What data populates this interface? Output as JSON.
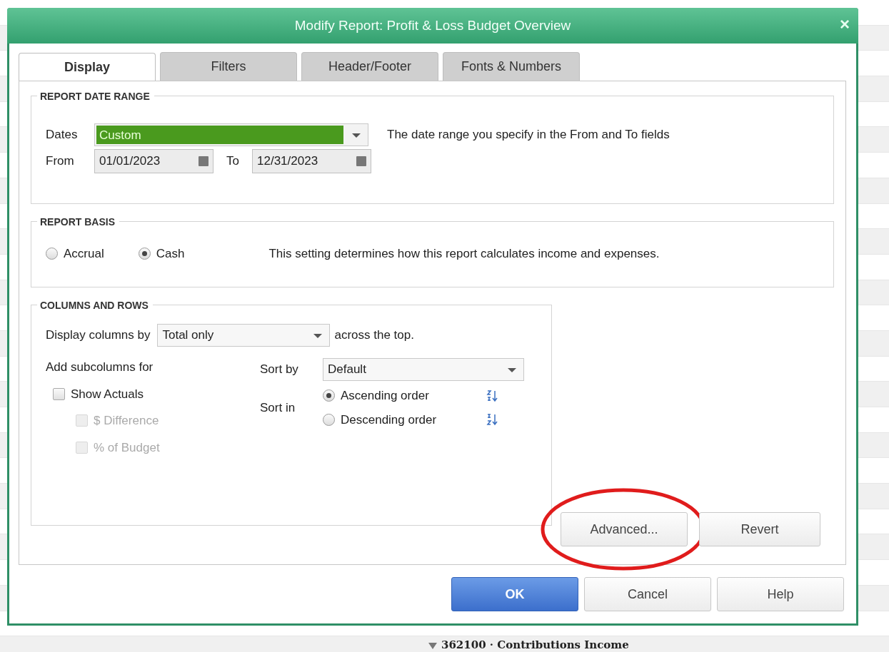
{
  "window": {
    "title": "Modify Report: Profit & Loss Budget Overview",
    "close": "×"
  },
  "tabs": [
    {
      "label": "Display",
      "selected": true
    },
    {
      "label": "Filters",
      "selected": false
    },
    {
      "label": "Header/Footer",
      "selected": false
    },
    {
      "label": "Fonts & Numbers",
      "selected": false
    }
  ],
  "date_range": {
    "heading": "REPORT DATE RANGE",
    "dates_label": "Dates",
    "dates_value": "Custom",
    "hint": "The date range you specify in the From and To fields",
    "from_label": "From",
    "from_value": "01/01/2023",
    "to_label": "To",
    "to_value": "12/31/2023"
  },
  "report_basis": {
    "heading": "REPORT BASIS",
    "options": [
      {
        "label": "Accrual",
        "selected": false
      },
      {
        "label": "Cash",
        "selected": true
      }
    ],
    "hint": "This setting determines how this report calculates income and expenses."
  },
  "columns_rows": {
    "heading": "COLUMNS AND ROWS",
    "display_label": "Display columns by",
    "display_value": "Total only",
    "display_suffix": "across the top.",
    "subcolumns_label": "Add subcolumns for",
    "subcolumns": [
      {
        "label": "Show Actuals",
        "checked": false,
        "disabled": false,
        "children": [
          {
            "label": "$ Difference",
            "checked": false,
            "disabled": true
          },
          {
            "label": "% of Budget",
            "checked": false,
            "disabled": true
          }
        ]
      }
    ],
    "sort_by_label": "Sort by",
    "sort_by_value": "Default",
    "sort_in_label": "Sort in",
    "sort_orders": [
      {
        "label": "Ascending order",
        "selected": true,
        "kind": "ascending"
      },
      {
        "label": "Descending order",
        "selected": false,
        "kind": "descending"
      }
    ]
  },
  "panel_buttons": [
    {
      "label": "Advanced...",
      "circled": true
    },
    {
      "label": "Revert",
      "circled": false
    }
  ],
  "buttons": [
    {
      "label": "OK",
      "kind": "primary"
    },
    {
      "label": "Cancel",
      "kind": "default"
    },
    {
      "label": "Help",
      "kind": "default"
    }
  ],
  "background_report": {
    "row": "362100 · Contributions Income"
  }
}
